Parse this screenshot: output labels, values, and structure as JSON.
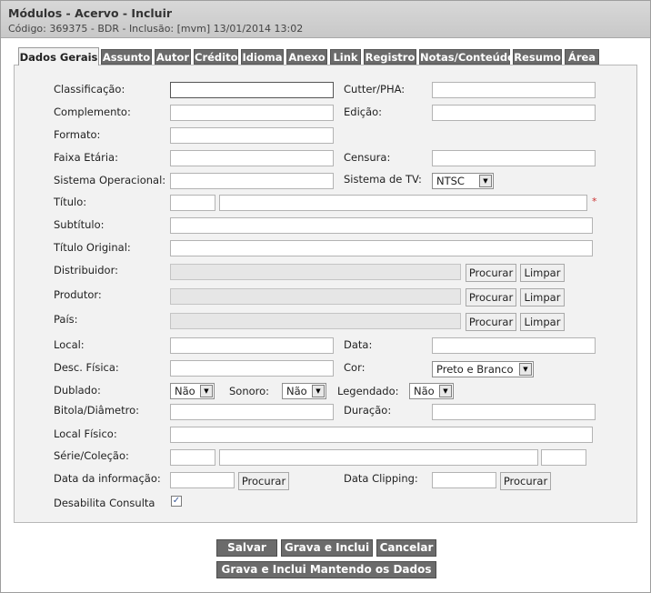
{
  "header": {
    "title": "Módulos - Acervo - Incluir",
    "subtitle": "Código: 369375 - BDR - Inclusão: [mvm] 13/01/2014 13:02"
  },
  "tabs": [
    "Dados Gerais",
    "Assunto",
    "Autor",
    "Crédito",
    "Idioma",
    "Anexo",
    "Link",
    "Registro",
    "Notas/Conteúdo",
    "Resumo",
    "Área"
  ],
  "form": {
    "classificacao": "Classificação:",
    "cutter": "Cutter/PHA:",
    "complemento": "Complemento:",
    "edicao": "Edição:",
    "formato": "Formato:",
    "faixa_etaria": "Faixa Etária:",
    "censura": "Censura:",
    "sistema_operacional": "Sistema Operacional:",
    "sistema_tv": "Sistema de TV:",
    "sistema_tv_value": "NTSC",
    "titulo": "Título:",
    "required_mark": "*",
    "subtitulo": "Subtítulo:",
    "titulo_original": "Título Original:",
    "distribuidor": "Distribuidor:",
    "produtor": "Produtor:",
    "pais": "País:",
    "local": "Local:",
    "data": "Data:",
    "desc_fisica": "Desc. Física:",
    "cor": "Cor:",
    "cor_value": "Preto e Branco",
    "dublado": "Dublado:",
    "dublado_value": "Não",
    "sonoro": "Sonoro:",
    "sonoro_value": "Não",
    "legendado": "Legendado:",
    "legendado_value": "Não",
    "bitola": "Bitola/Diâmetro:",
    "duracao": "Duração:",
    "local_fisico": "Local Físico:",
    "serie": "Série/Coleção:",
    "data_informacao": "Data da informação:",
    "data_clipping": "Data Clipping:",
    "desabilita": "Desabilita Consulta",
    "desabilita_checked": "✓",
    "procurar": "Procurar",
    "limpar": "Limpar"
  },
  "actions": {
    "salvar": "Salvar",
    "grava_inclui": "Grava e Inclui",
    "cancelar": "Cancelar",
    "grava_mantendo": "Grava e Inclui Mantendo os Dados"
  },
  "colors": {
    "tab_bg": "#6b6b6b",
    "panel_bg": "#f2f2f2",
    "titlebar_bg": "#d0d0d0",
    "required": "#cc3333"
  }
}
